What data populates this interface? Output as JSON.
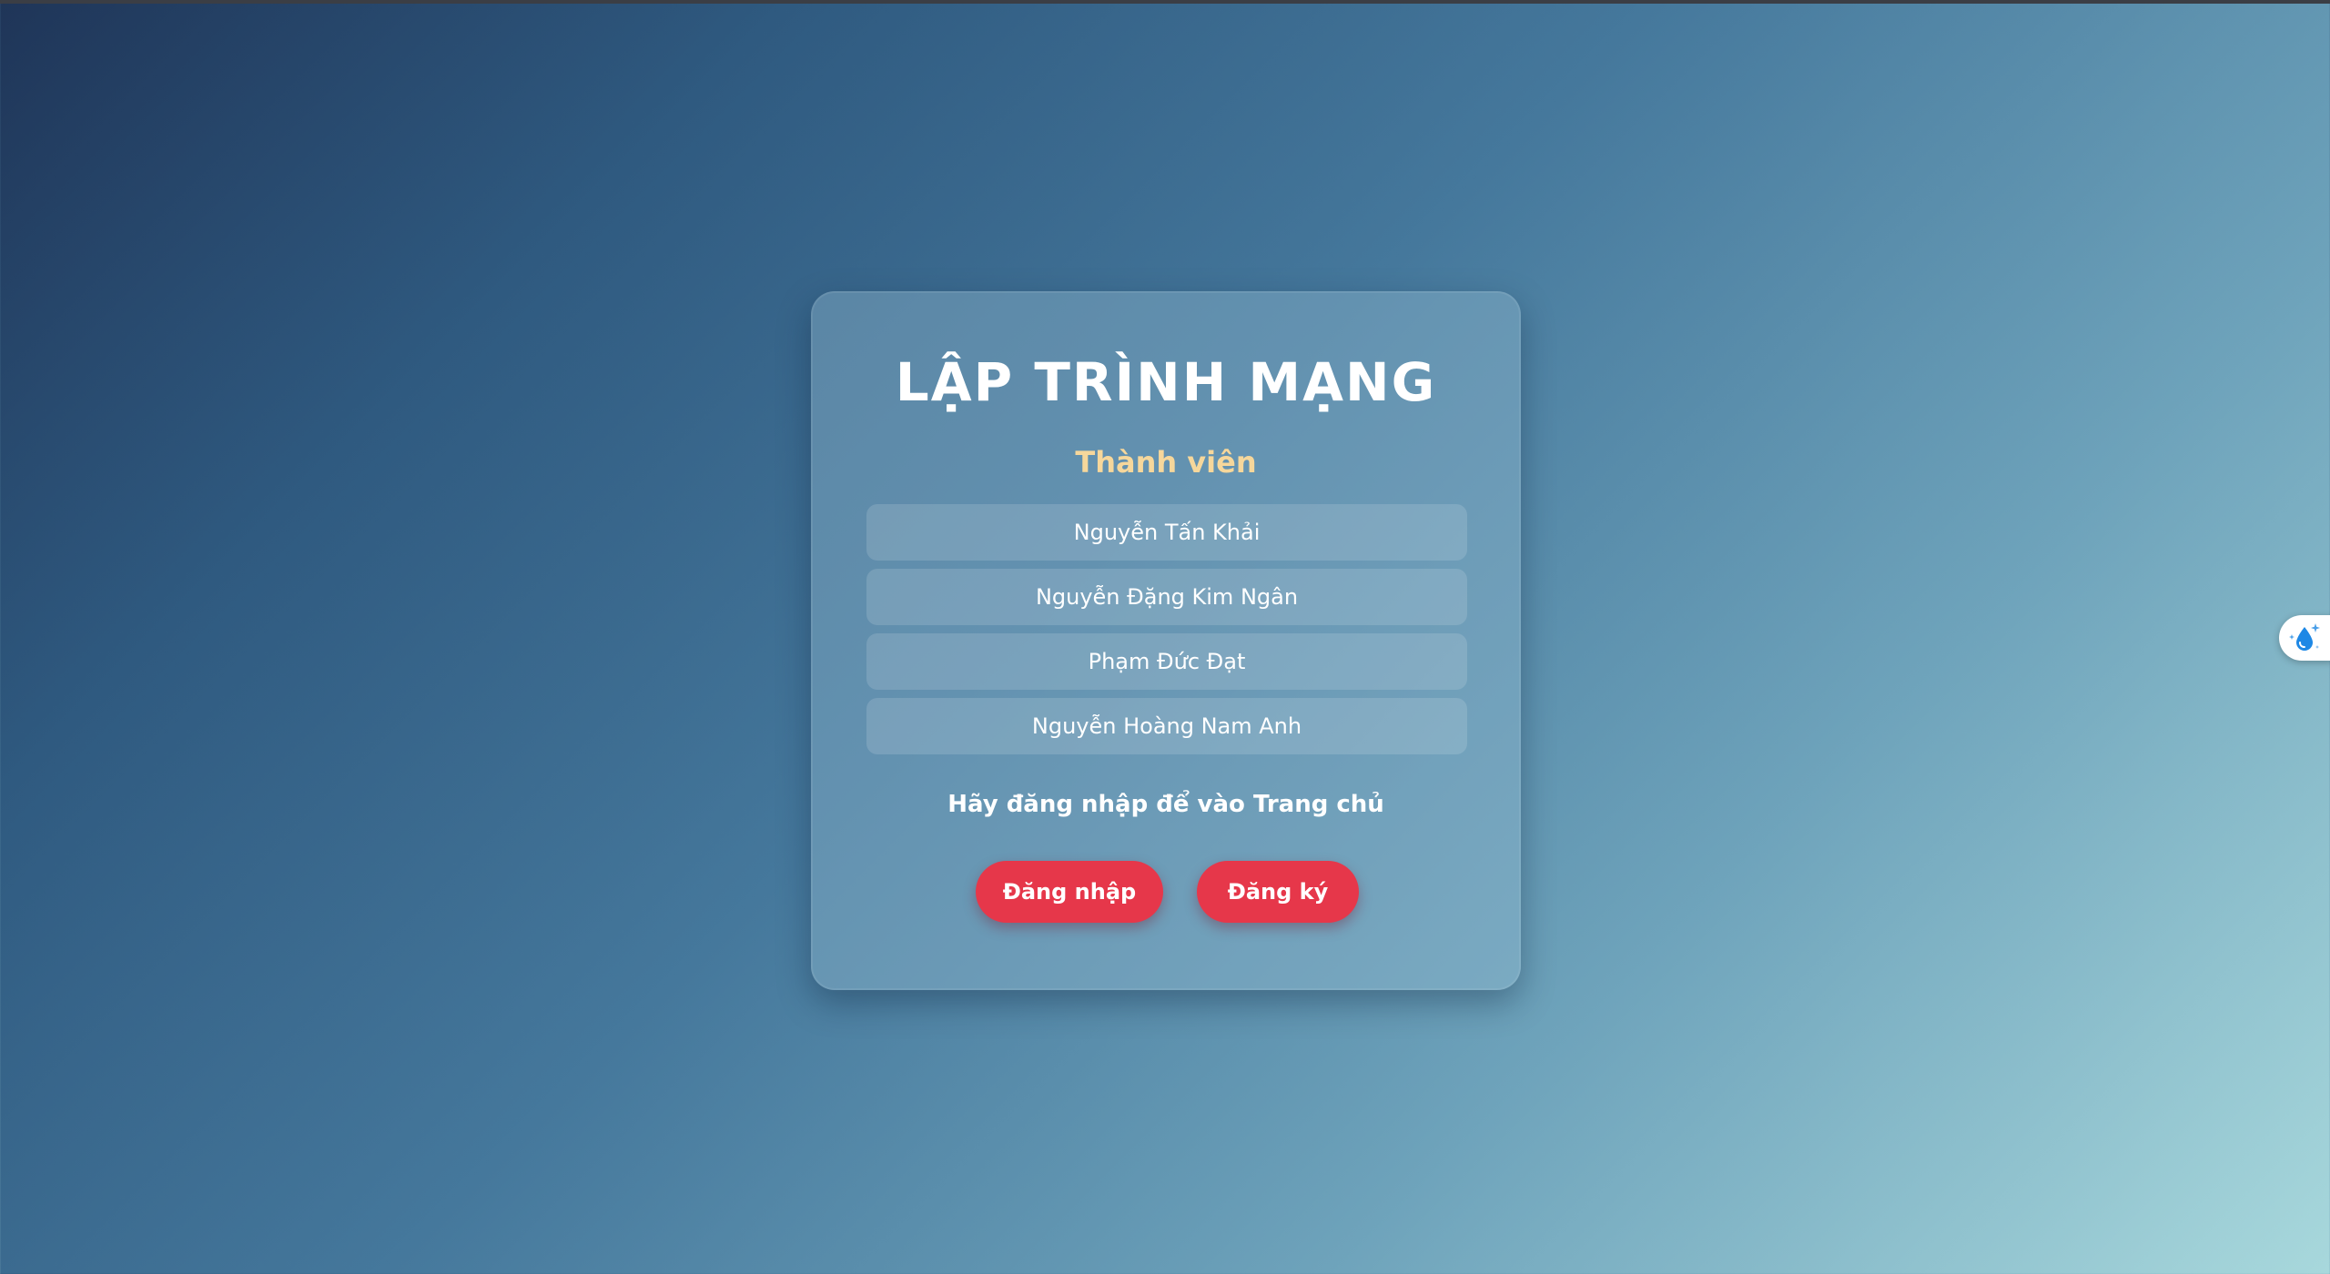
{
  "page": {
    "title": "LẬP TRÌNH MẠNG",
    "members_heading": "Thành viên",
    "members": [
      "Nguyễn Tấn Khải",
      "Nguyễn Đặng Kim Ngân",
      "Phạm Đức Đạt",
      "Nguyễn Hoàng Nam Anh"
    ],
    "prompt": "Hãy đăng nhập để vào Trang chủ",
    "login_label": "Đăng nhập",
    "register_label": "Đăng ký"
  },
  "widget": {
    "icon": "water-drop-sparkle-icon"
  },
  "colors": {
    "accent": "#e6374a",
    "heading_accent": "#f6d79b",
    "text": "#ffffff"
  }
}
